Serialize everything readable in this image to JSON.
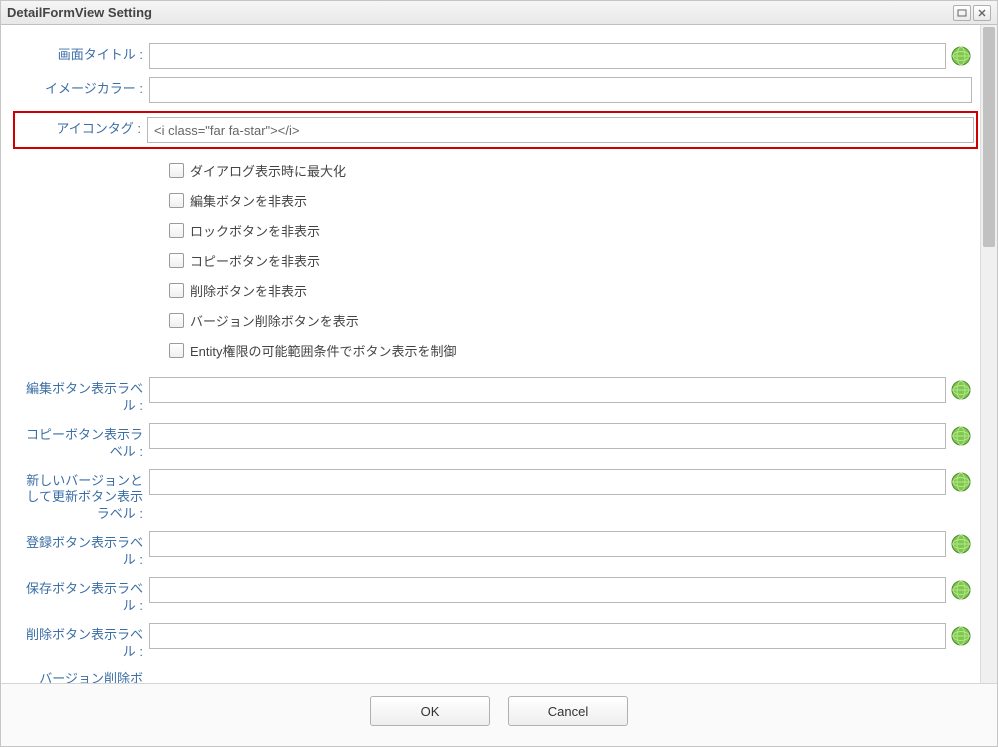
{
  "window": {
    "title": "DetailFormView Setting",
    "maximize_label": "maximize",
    "close_label": "close"
  },
  "fields": {
    "screen_title_label": "画面タイトル :",
    "screen_title_value": "",
    "image_color_label": "イメージカラー :",
    "image_color_value": "",
    "icon_tag_label": "アイコンタグ :",
    "icon_tag_value": "<i class=\"far fa-star\"></i>",
    "edit_btn_label_label": "編集ボタン表示ラベル :",
    "edit_btn_label_value": "",
    "copy_btn_label_label": "コピーボタン表示ラベル :",
    "copy_btn_label_value": "",
    "new_version_label_label": "新しいバージョンとして更新ボタン表示ラベル :",
    "new_version_label_value": "",
    "register_btn_label_label": "登録ボタン表示ラベル :",
    "register_btn_label_value": "",
    "save_btn_label_label": "保存ボタン表示ラベル :",
    "save_btn_label_value": "",
    "delete_btn_label_label": "削除ボタン表示ラベル :",
    "delete_btn_label_value": "",
    "truncated_label": "バージョン削除ボ"
  },
  "checkboxes": {
    "maximize_on_dialog": "ダイアログ表示時に最大化",
    "hide_edit_button": "編集ボタンを非表示",
    "hide_lock_button": "ロックボタンを非表示",
    "hide_copy_button": "コピーボタンを非表示",
    "hide_delete_button": "削除ボタンを非表示",
    "show_version_delete": "バージョン削除ボタンを表示",
    "entity_auth_control": "Entity権限の可能範囲条件でボタン表示を制御"
  },
  "footer": {
    "ok": "OK",
    "cancel": "Cancel"
  }
}
